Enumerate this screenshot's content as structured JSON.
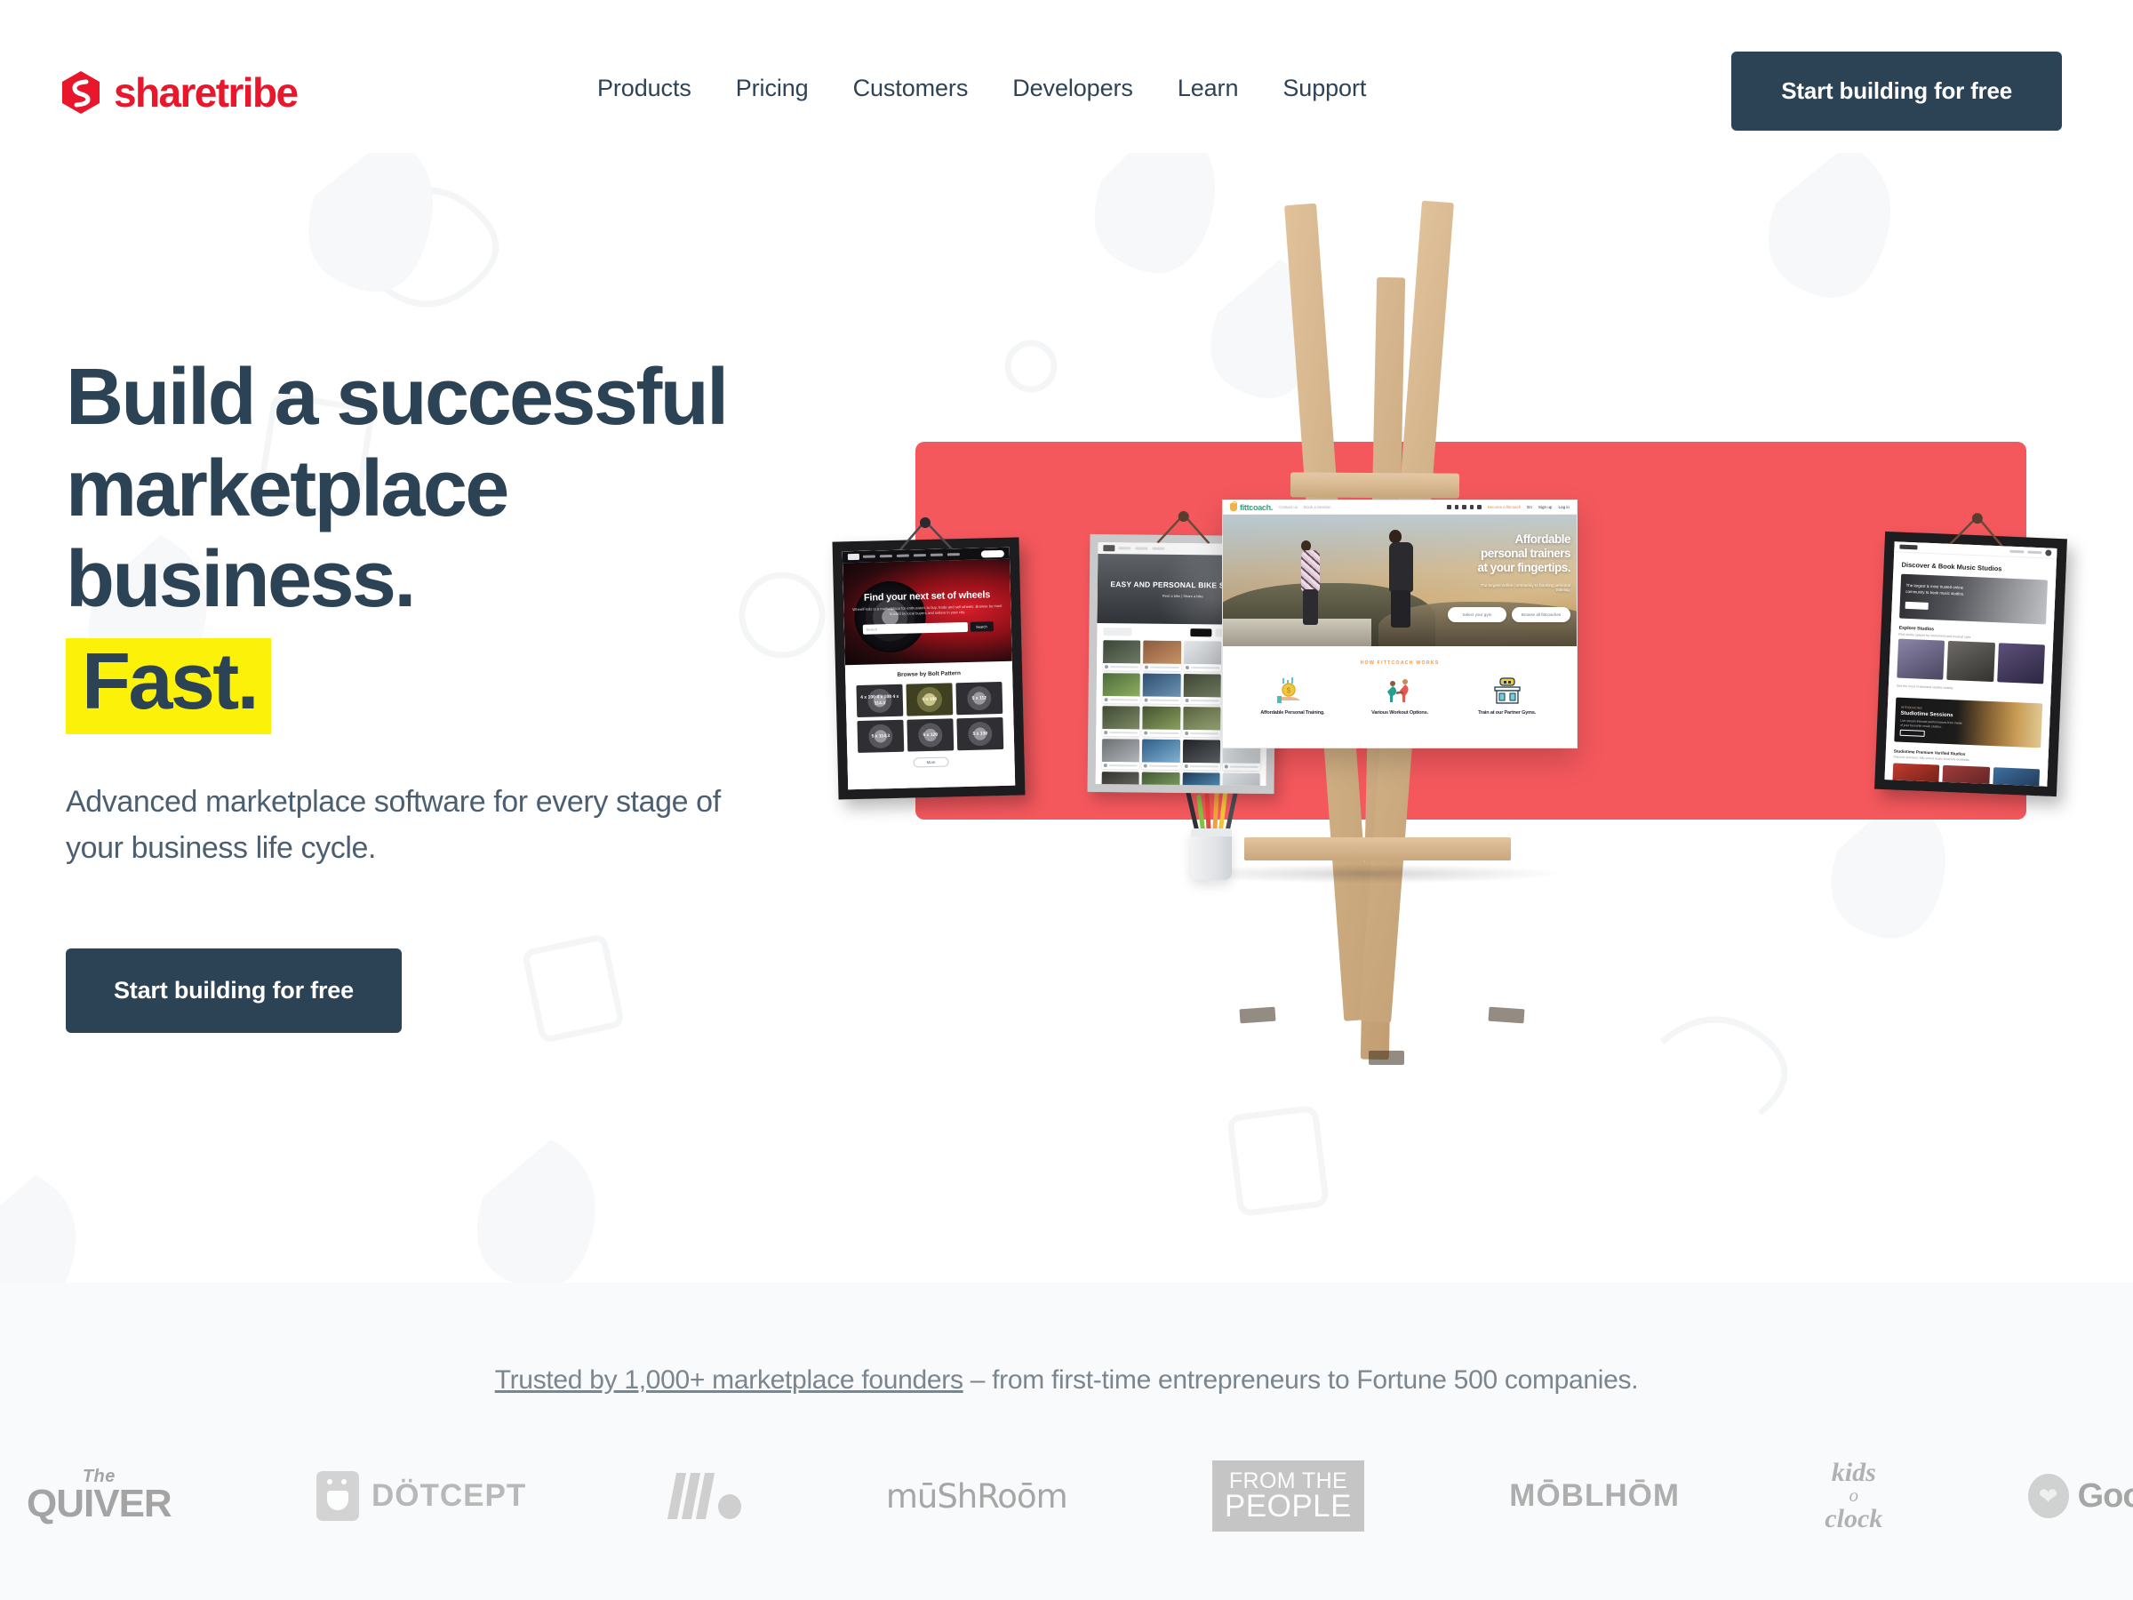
{
  "brand": {
    "name": "sharetribe",
    "logo_icon": "sharetribe-hexagon-logo",
    "accent_red": "#e8172b",
    "navy": "#2c4255",
    "highlight_yellow": "#fbf109",
    "coral": "#f4585d"
  },
  "header": {
    "nav": [
      {
        "label": "Products"
      },
      {
        "label": "Pricing"
      },
      {
        "label": "Customers"
      },
      {
        "label": "Developers"
      },
      {
        "label": "Learn"
      },
      {
        "label": "Support"
      }
    ],
    "cta_label": "Start building for free"
  },
  "hero": {
    "headline_line1": "Build a successful",
    "headline_line2": "marketplace",
    "headline_line3": "business.",
    "headline_highlight": "Fast.",
    "subhead": "Advanced marketplace software for every stage of your business life cycle.",
    "cta_label": "Start building for free"
  },
  "artwork": {
    "wheels": {
      "hero_title": "Find your next set of wheels",
      "hero_sub": "WheelFinds is a marketplace for enthusiasts to buy, trade and sell wheels. Browse by most trusted by local buyers and sellers in your city.",
      "search_placeholder": "Search",
      "search_button": "Search",
      "section_title": "Browse by Bolt Pattern",
      "bolt_patterns": [
        "4 x 100\n4 x 108\n4 x 114.3",
        "5 x 100",
        "5 x 112",
        "5 x 114.3",
        "5 x 120",
        "5 x 130"
      ],
      "more_label": "More"
    },
    "bikes": {
      "hero_title": "EASY AND PERSONAL BIKE SHARING",
      "hero_sub": "Rent a bike  |  Share a bike"
    },
    "fittcoach": {
      "logo": "fittcoach.",
      "nav": [
        "Contact us",
        "Book a Session"
      ],
      "right_links": [
        "Become a fittcoach",
        "En",
        "Sign up",
        "Log in"
      ],
      "hero_title_line1": "Affordable",
      "hero_title_line2": "personal trainers",
      "hero_title_line3": "at your fingertips.",
      "hero_sub": "The largest online community to booking personal training.",
      "btn_primary": "Select your gym",
      "btn_secondary": "Browse all fittcoaches",
      "works_kicker": "HOW FITTCOACH WORKS",
      "features": [
        {
          "icon": "money-hand-icon",
          "label": "Affordable Personal Training."
        },
        {
          "icon": "exercising-people-icon",
          "label": "Various Workout Options."
        },
        {
          "icon": "gym-building-icon",
          "label": "Train at our Partner Gyms."
        }
      ]
    },
    "studios": {
      "title": "Discover & Book Music Studios",
      "hero_text": "The largest & most trusted online community to book music studios.",
      "hero_btn": "Get started",
      "explore_title": "Explore Studios",
      "explore_sub": "Find studio spaces by instrument and musical style.",
      "explore_note": "See the most in-demand studios nearby.",
      "band_kicker": "INTRODUCING",
      "band_title": "Studiotime Sessions",
      "band_sub": "Live stream intimate performances from inside of your favourite music studios.",
      "band_btn": "Learn more",
      "footer_title": "Studiotime Premium Verified Studios",
      "footer_sub": "Discover premium, fully vetted studio locations worldwide."
    }
  },
  "trusted": {
    "link_text": "Trusted by 1,000+ marketplace founders",
    "rest_text": " – from first-time entrepreneurs to Fortune 500 companies.",
    "logos": [
      {
        "name": "The QUIVER",
        "the": "The",
        "word": "QUIVER"
      },
      {
        "name": "DOTCEPT",
        "word": "DÖTCEPT"
      },
      {
        "name": "Wavemaker",
        "word": ""
      },
      {
        "name": "mushroom",
        "word": "mūShRoōm"
      },
      {
        "name": "FROM THE PEOPLE",
        "row1": "FROM THE",
        "row2": "PEOPLE"
      },
      {
        "name": "MOBLHOM",
        "word": "MŌBLHŌM"
      },
      {
        "name": "kids o clock",
        "line1": "kids",
        "line2": "o",
        "line3": "clock"
      },
      {
        "name": "Goodwill",
        "word": "Goodwill"
      }
    ]
  }
}
